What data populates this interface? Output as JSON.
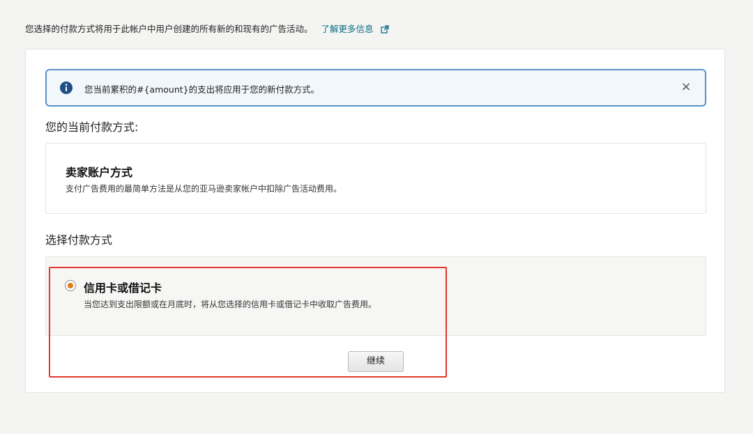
{
  "top_note": {
    "text": "您选择的付款方式将用于此帐户中用户创建的所有新的和现有的广告活动。",
    "link_label": "了解更多信息"
  },
  "alert": {
    "icon": "info-icon",
    "text": "您当前累积的#{amount}的支出将应用于您的新付款方式。",
    "close_label": "×"
  },
  "current_method": {
    "heading": "您的当前付款方式:",
    "title": "卖家账户方式",
    "description": "支付广告费用的最简单方法是从您的亚马逊卖家帐户中扣除广告活动费用。"
  },
  "choose_method": {
    "heading": "选择付款方式",
    "options": [
      {
        "title": "信用卡或借记卡",
        "description": "当您达到支出限额或在月底时，将从您选择的信用卡或借记卡中收取广告费用。",
        "selected": true
      }
    ]
  },
  "continue_label": "继续",
  "colors": {
    "link": "#0a6e86",
    "alert_border": "#5b91c6",
    "alert_icon": "#1c4f85",
    "radio_selected": "#e27b14",
    "highlight": "#e2372a"
  }
}
